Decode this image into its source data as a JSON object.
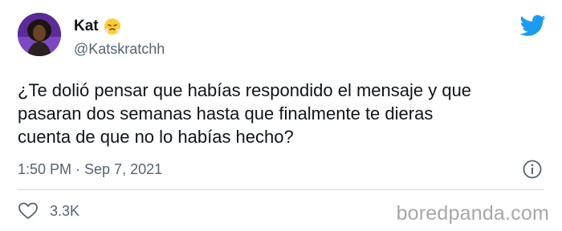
{
  "author": {
    "display_name": "Kat",
    "handle": "@Katskratchh",
    "name_emoji": "😤"
  },
  "tweet": {
    "text": "¿Te dolió pensar que habías respondido el mensaje y que\npasaran dos semanas hasta que finalmente te dieras\ncuenta de que no lo habías hecho?",
    "meta": "1:50 PM · Sep 7, 2021",
    "likes": "3.3K"
  },
  "icons": {
    "brand": "twitter-bird-icon",
    "info": "info-icon",
    "like": "heart-icon"
  },
  "watermark": "boredpanda.com",
  "colors": {
    "twitter_blue": "#1d9bf0",
    "text_primary": "#0f1419",
    "text_secondary": "#536471",
    "divider": "#cfd9de",
    "watermark": "#a7a7a7"
  }
}
